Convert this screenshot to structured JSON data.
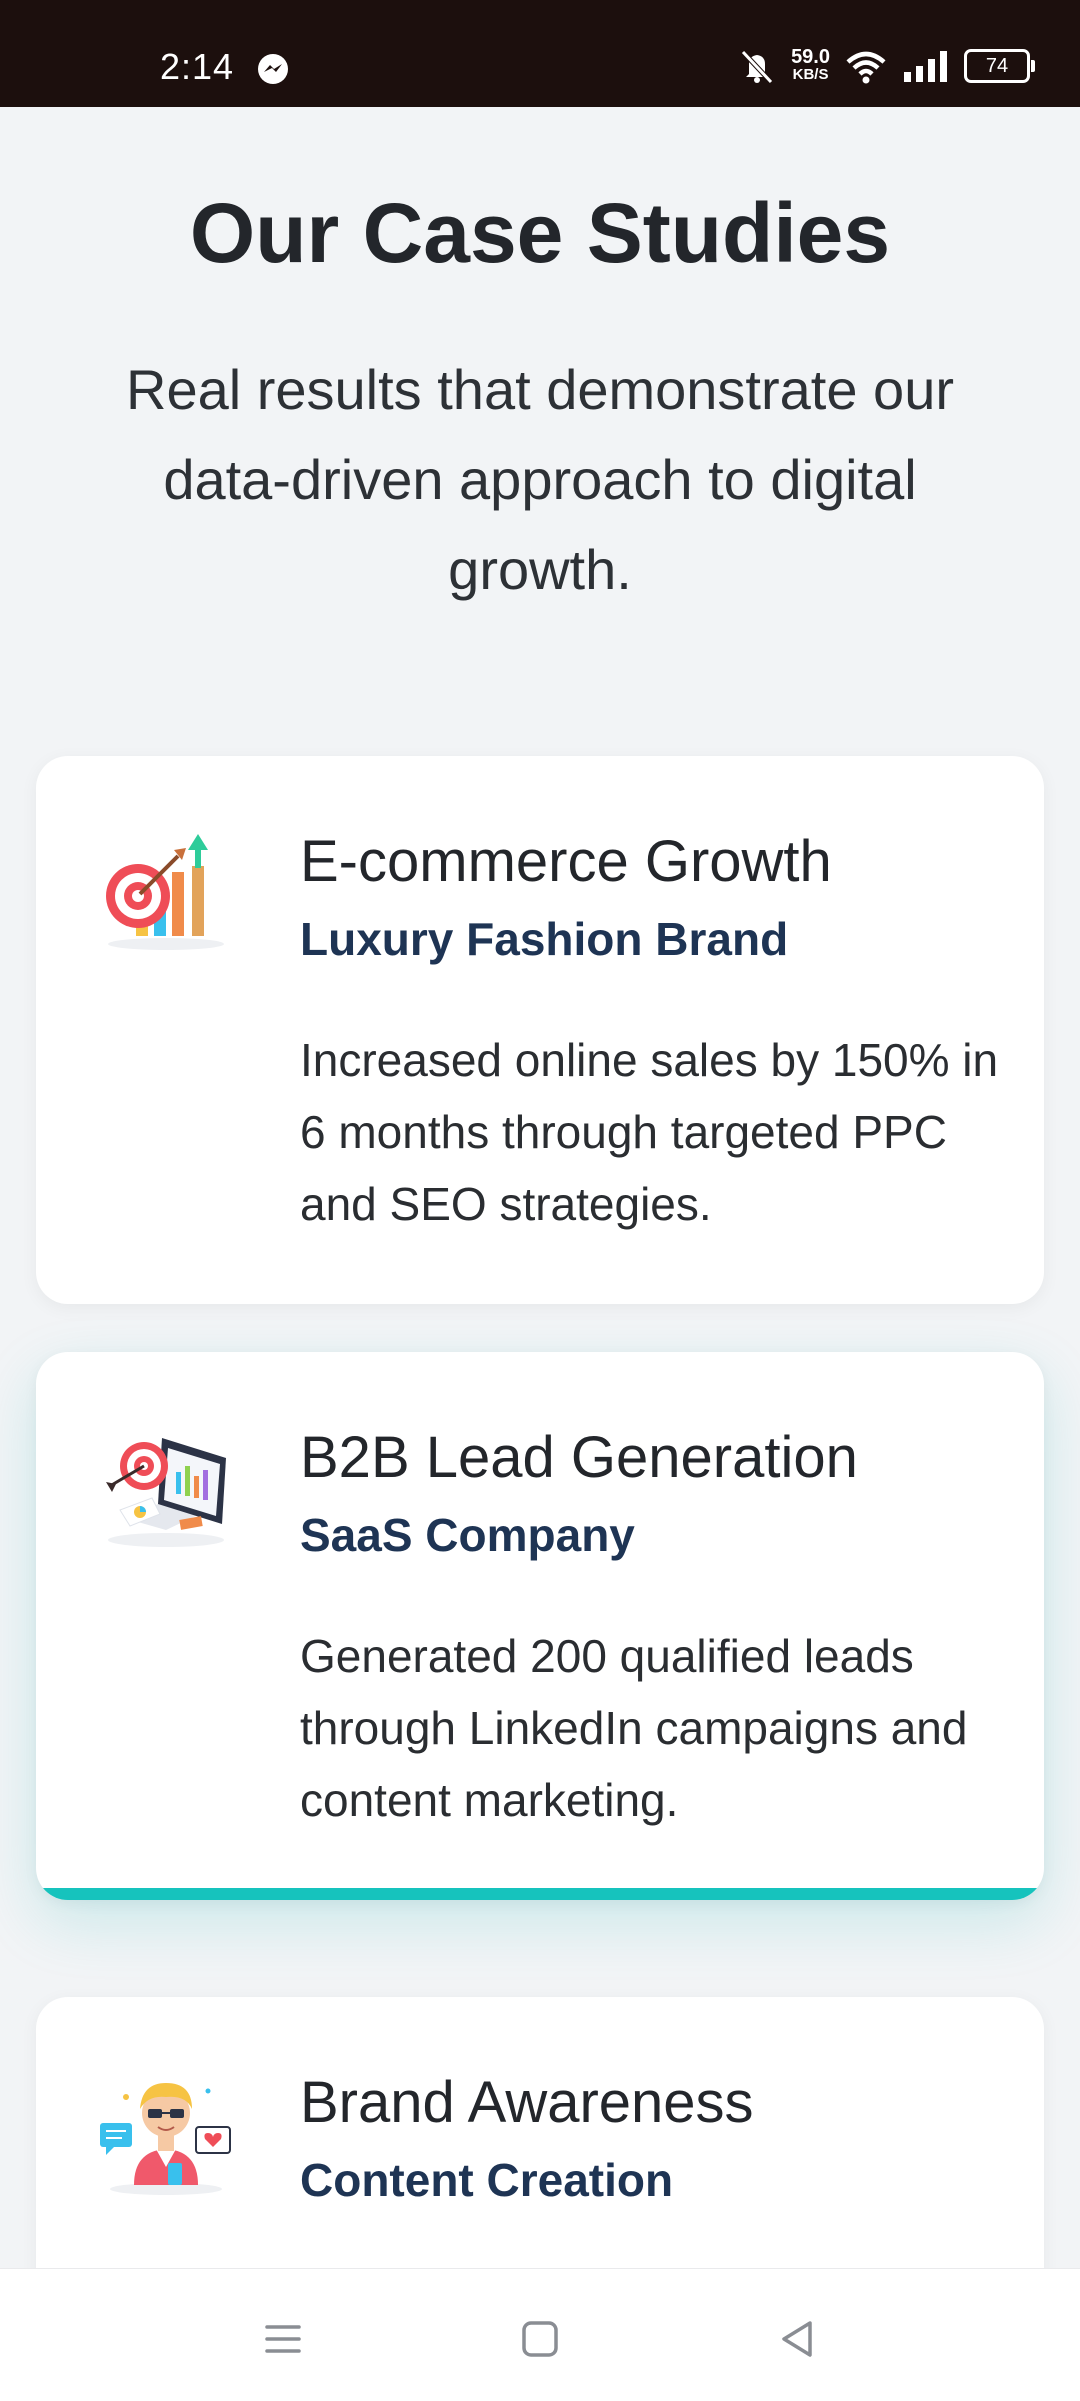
{
  "status_bar": {
    "time": "2:14",
    "net_speed": "59.0",
    "net_unit": "KB/S",
    "battery": "74",
    "icons": [
      "messenger-icon",
      "mute-icon",
      "wifi-icon",
      "signal-icon",
      "battery-icon"
    ]
  },
  "header": {
    "title": "Our Case Studies",
    "subtitle": "Real results that demonstrate our data-driven approach to digital growth."
  },
  "cards": [
    {
      "icon": "target-growth-icon",
      "title": "E-commerce Growth",
      "subtitle": "Luxury Fashion Brand",
      "description": "Increased online sales by 150% in 6 months through targeted PPC and SEO strategies."
    },
    {
      "icon": "lead-generation-icon",
      "title": "B2B Lead Generation",
      "subtitle": "SaaS Company",
      "description": "Generated 200 qualified leads through LinkedIn campaigns and content marketing."
    },
    {
      "icon": "brand-awareness-icon",
      "title": "Brand Awareness",
      "subtitle": "Content Creation",
      "description": ""
    }
  ],
  "colors": {
    "accent": "#16c3bd",
    "subtitle_blue": "#1e3454",
    "background": "#f2f4f6"
  },
  "nav_bar": {
    "icons": [
      "menu-icon",
      "home-icon",
      "back-icon"
    ]
  }
}
